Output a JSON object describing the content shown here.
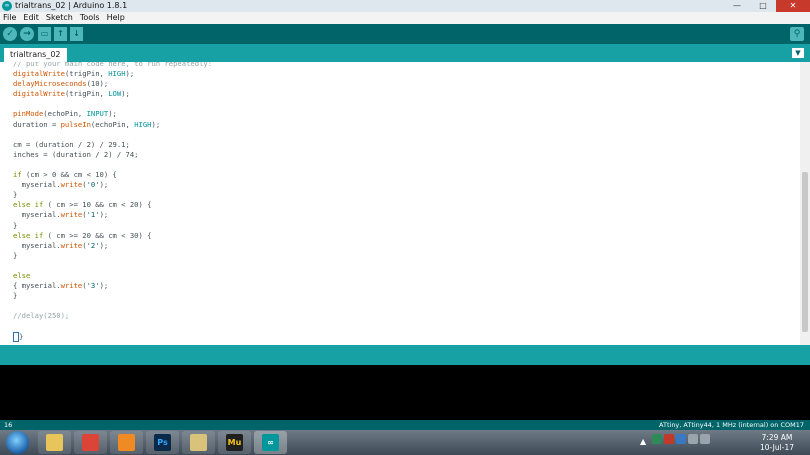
{
  "window": {
    "title": "trialtrans_02 | Arduino 1.8.1",
    "app_icon": "arduino-icon"
  },
  "menu": [
    "File",
    "Edit",
    "Sketch",
    "Tools",
    "Help"
  ],
  "toolbar": {
    "verify_glyph": "✓",
    "upload_glyph": "→",
    "new_glyph": "▭",
    "open_glyph": "↑",
    "save_glyph": "↓",
    "serial_glyph": "⚲"
  },
  "tab": {
    "name": "trialtrans_02",
    "menu_glyph": "▼"
  },
  "code": [
    "// put your main code here, to run repeatedly:",
    "digitalWrite(trigPin, HIGH);",
    "delayMicroseconds(10);",
    "digitalWrite(trigPin, LOW);",
    "",
    "pinMode(echoPin, INPUT);",
    "duration = pulseIn(echoPin, HIGH);",
    "",
    "cm = (duration / 2) / 29.1;",
    "inches = (duration / 2) / 74;",
    "",
    "if (cm > 0 && cm < 10) {",
    "  myserial.write('0');",
    "}",
    "else if ( cm >= 10 && cm < 20) {",
    "  myserial.write('1');",
    "}",
    "else if ( cm >= 20 && cm < 30) {",
    "  myserial.write('2');",
    "}",
    "",
    "else",
    "{ myserial.write('3');",
    "}",
    "",
    "//delay(250);",
    "",
    "}"
  ],
  "status": {
    "line": "16",
    "board": "ATtiny, ATtiny44, 1 MHz (internal) on COM17"
  },
  "taskbar": {
    "apps": [
      {
        "icon": "file-explorer-icon",
        "label": "",
        "color": "#e8c55a"
      },
      {
        "icon": "chrome-icon",
        "label": "",
        "color": "#db4437"
      },
      {
        "icon": "media-player-icon",
        "label": "",
        "color": "#f08a24"
      },
      {
        "icon": "photoshop-icon",
        "label": "Ps",
        "color": "#0b2a4a"
      },
      {
        "icon": "folder-icon",
        "label": "",
        "color": "#d9c27a"
      },
      {
        "icon": "muse-icon",
        "label": "Mu",
        "color": "#1f1f1f"
      },
      {
        "icon": "arduino-taskbar-icon",
        "label": "∞",
        "color": "#00979c"
      }
    ],
    "time": "7:29 AM",
    "date": "10-Jul-17"
  },
  "colors": {
    "teal_dark": "#006468",
    "teal_light": "#17a1a5",
    "accent": "#4db7bb"
  }
}
